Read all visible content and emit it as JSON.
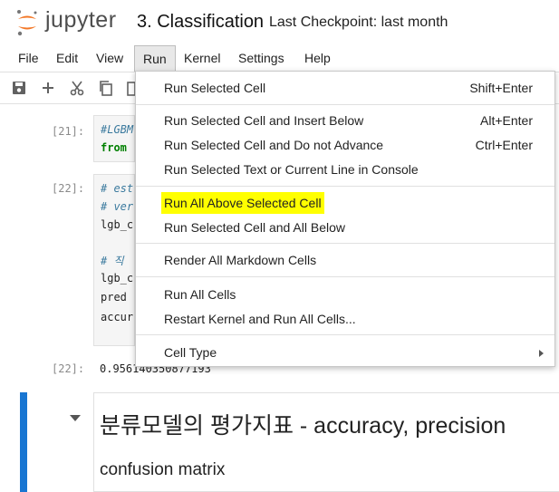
{
  "header": {
    "logo_text": "jupyter",
    "notebook_title": "3. Classification",
    "checkpoint": "Last Checkpoint: last month"
  },
  "menubar": {
    "items": [
      "File",
      "Edit",
      "View",
      "Run",
      "Kernel",
      "Settings",
      "Help"
    ],
    "active": "Run"
  },
  "toolbar": {
    "icons": [
      "save-icon",
      "add-icon",
      "cut-icon",
      "copy-icon",
      "paste-icon"
    ]
  },
  "cells": {
    "cell21": {
      "prompt": "[21]:",
      "lines": [
        "#LGBM",
        "from"
      ]
    },
    "cell22": {
      "prompt": "[22]:",
      "lines": [
        "# est",
        "# ver",
        "lgb_c",
        "# 직",
        "lgb_c",
        "pred",
        "accur"
      ],
      "output_prompt": "[22]:",
      "output": "0.956140350877193"
    },
    "markdown": {
      "heading": "분류모델의 평가지표 - accuracy, precision",
      "subheading": "confusion matrix"
    }
  },
  "run_menu": {
    "items": [
      {
        "label": "Run Selected Cell",
        "shortcut": "Shift+Enter"
      },
      {
        "label": "Run Selected Cell and Insert Below",
        "shortcut": "Alt+Enter"
      },
      {
        "label": "Run Selected Cell and Do not Advance",
        "shortcut": "Ctrl+Enter"
      },
      {
        "label": "Run Selected Text or Current Line in Console",
        "shortcut": ""
      },
      {
        "label": "Run All Above Selected Cell",
        "shortcut": ""
      },
      {
        "label": "Run Selected Cell and All Below",
        "shortcut": ""
      },
      {
        "label": "Render All Markdown Cells",
        "shortcut": ""
      },
      {
        "label": "Run All Cells",
        "shortcut": ""
      },
      {
        "label": "Restart Kernel and Run All Cells...",
        "shortcut": ""
      },
      {
        "label": "Cell Type",
        "shortcut": ""
      }
    ],
    "highlighted": "Run All Above Selected Cell",
    "highlight_color": "#ffff00"
  },
  "colors": {
    "accent": "#1976d2",
    "logo_orange": "#f37726"
  }
}
